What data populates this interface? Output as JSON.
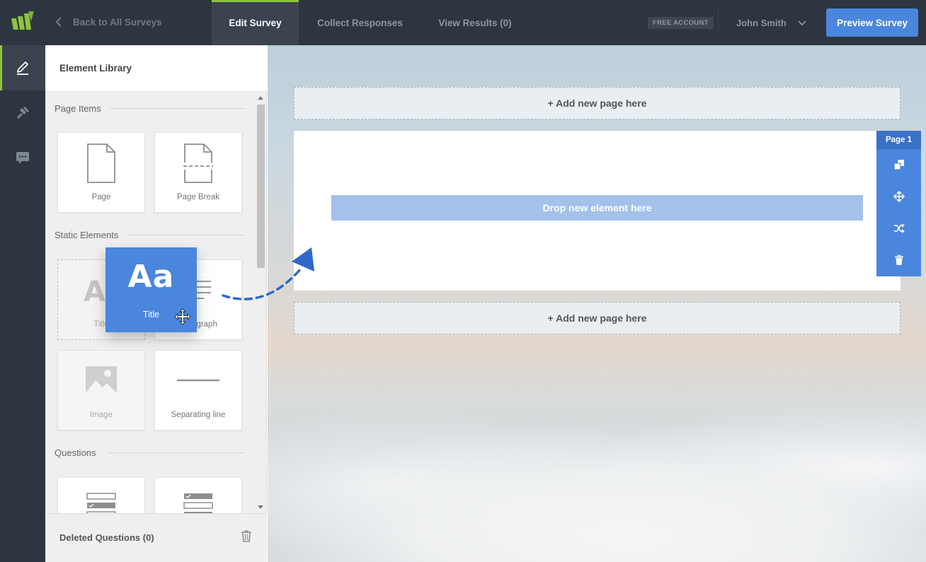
{
  "header": {
    "back_label": "Back to All Surveys",
    "tabs": [
      {
        "label": "Edit Survey",
        "active": true
      },
      {
        "label": "Collect Responses",
        "active": false
      },
      {
        "label": "View Results (0)",
        "active": false
      }
    ],
    "account_badge": "FREE ACCOUNT",
    "user_name": "John Smith",
    "preview_button": "Preview Survey"
  },
  "rail": {
    "items": [
      {
        "icon": "pencil-icon",
        "active": true
      },
      {
        "icon": "hammer-icon",
        "active": false
      },
      {
        "icon": "comment-icon",
        "active": false
      }
    ]
  },
  "library": {
    "title": "Element Library",
    "sections": [
      {
        "label": "Page Items",
        "items": [
          {
            "label": "Page",
            "icon": "page-icon"
          },
          {
            "label": "Page Break",
            "icon": "page-break-icon"
          }
        ]
      },
      {
        "label": "Static Elements",
        "items": [
          {
            "label": "Title",
            "icon": "title-icon"
          },
          {
            "label": "Paragraph",
            "icon": "paragraph-icon"
          },
          {
            "label": "Image",
            "icon": "image-icon"
          },
          {
            "label": "Separating line",
            "icon": "separator-icon"
          }
        ]
      },
      {
        "label": "Questions",
        "items": [
          {
            "label": "",
            "icon": "single-choice-icon"
          },
          {
            "label": "",
            "icon": "multiple-choice-icon"
          }
        ]
      }
    ],
    "footer_label": "Deleted Questions (0)"
  },
  "drag": {
    "glyph": "Aa",
    "label": "Title"
  },
  "canvas": {
    "add_page_label": "+ Add new page here",
    "drop_label": "Drop new element here",
    "page_label": "Page 1",
    "tools": [
      "copy-icon",
      "move-icon",
      "shuffle-icon",
      "trash-icon"
    ]
  },
  "colors": {
    "topbar": "#2d3540",
    "accent_green": "#8cc43f",
    "primary_blue": "#4a86dd",
    "drop_zone": "#a4c1ea"
  }
}
